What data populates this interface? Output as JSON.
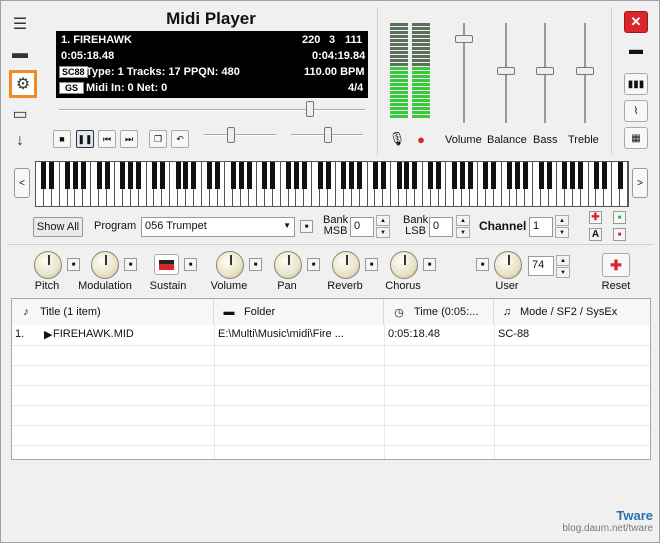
{
  "app": {
    "title": "Midi Player"
  },
  "lcd": {
    "track_title": "1. FIREHAWK",
    "stat1": "220",
    "stat2": "3",
    "stat3": "111",
    "elapsed": "0:05:18.48",
    "total": "0:04:19.84",
    "sc88_tag": "SC88",
    "info": "Type: 1  Tracks: 17  PPQN: 480",
    "bpm": "110.00 BPM",
    "gs_tag": "GS",
    "midi_info": "Midi In: 0  Net: 0",
    "time_sig": "4/4"
  },
  "progress": {
    "position_fraction": 0.82
  },
  "mixer": {
    "volume_label": "Volume",
    "balance_label": "Balance",
    "bass_label": "Bass",
    "treble_label": "Treble",
    "vu_left_level": 0.55,
    "vu_right_level": 0.55
  },
  "program": {
    "show_all_label": "Show All",
    "program_label": "Program",
    "program_value": "056 Trumpet",
    "bank_msb_label1": "Bank",
    "bank_msb_label2": "MSB",
    "bank_msb_value": "0",
    "bank_lsb_label1": "Bank",
    "bank_lsb_label2": "LSB",
    "bank_lsb_value": "0",
    "channel_label": "Channel",
    "channel_value": "1",
    "a_label": "A"
  },
  "controls": {
    "pitch": "Pitch",
    "modulation": "Modulation",
    "sustain": "Sustain",
    "volume": "Volume",
    "pan": "Pan",
    "reverb": "Reverb",
    "chorus": "Chorus",
    "user": "User",
    "user_value": "74",
    "reset": "Reset"
  },
  "playlist": {
    "col_title": "Title  (1 item)",
    "col_folder": "Folder",
    "col_time": "Time (0:05:...",
    "col_mode": "Mode / SF2 / SysEx",
    "rows": [
      {
        "num": "1.",
        "title": "FIREHAWK.MID",
        "folder": "E:\\Multi\\Music\\midi\\Fire ...",
        "time": "0:05:18.48",
        "mode": "SC-88"
      }
    ]
  },
  "brand": {
    "name": "Tware",
    "url": "blog.daum.net/tware"
  },
  "colors": {
    "accent": "#f08a24",
    "close": "#d9262b",
    "meter_green": "#39c93c",
    "meter_off": "#5c6e5c"
  }
}
